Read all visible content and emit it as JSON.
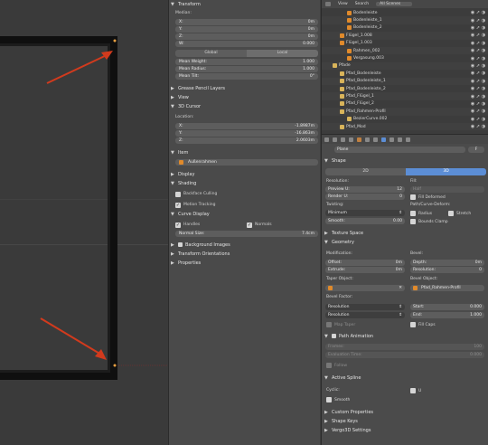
{
  "viewport": {},
  "npanel": {
    "transform": {
      "header": "Transform",
      "median_label": "Median:",
      "x": {
        "label": "X:",
        "value": "0m"
      },
      "y": {
        "label": "Y:",
        "value": "0m"
      },
      "z": {
        "label": "Z:",
        "value": "0m"
      },
      "w": {
        "label": "W:",
        "value": "0.000"
      },
      "global": "Global",
      "local": "Local",
      "mean_weight": {
        "label": "Mean Weight:",
        "value": "1.000"
      },
      "mean_radius": {
        "label": "Mean Radius:",
        "value": "1.000"
      },
      "mean_tilt": {
        "label": "Mean Tilt:",
        "value": "0°"
      }
    },
    "grease_pencil": "Grease Pencil Layers",
    "view": "View",
    "cursor": {
      "header": "3D Cursor",
      "location": "Location:",
      "x": {
        "label": "X:",
        "value": "-1.8987m"
      },
      "y": {
        "label": "Y:",
        "value": "-16.863m"
      },
      "z": {
        "label": "Z:",
        "value": "2.0603m"
      }
    },
    "item": {
      "header": "Item",
      "name": "Außenrahmen"
    },
    "display": "Display",
    "shading": {
      "header": "Shading",
      "backface": "Backface Culling",
      "matcap": "Motion Tracking"
    },
    "curve_display": {
      "header": "Curve Display",
      "handles": "Handles",
      "normals": "Normals",
      "normal_size_label": "Normal Size:",
      "normal_size": "7.4cm"
    },
    "background": "Background Images",
    "transform_orient": "Transform Orientations",
    "properties": "Properties"
  },
  "outliner": {
    "view": "View",
    "search": "Search",
    "scenes": "All Scenes",
    "rows": [
      {
        "label": "Bodenleiste",
        "color": "#e08a2b"
      },
      {
        "label": "Bodenleiste_1",
        "color": "#e08a2b"
      },
      {
        "label": "Bodenleiste_2",
        "color": "#e08a2b"
      },
      {
        "label": "Flügel_1.008",
        "color": "#e08a2b"
      },
      {
        "label": "Flügel_1.003",
        "color": "#e08a2b"
      },
      {
        "label": "Rahmen_002",
        "color": "#e08a2b"
      },
      {
        "label": "Vergasung.003",
        "color": "#e08a2b"
      },
      {
        "label": "Pfade",
        "color": "#d9b45a"
      },
      {
        "label": "Pfad_Bodenleiste",
        "color": "#d9b45a"
      },
      {
        "label": "Pfad_Bodenleiste_1",
        "color": "#d9b45a"
      },
      {
        "label": "Pfad_Bodenleiste_2",
        "color": "#d9b45a"
      },
      {
        "label": "Pfad_Flügel_1",
        "color": "#d9b45a"
      },
      {
        "label": "Pfad_Flügel_2",
        "color": "#d9b45a"
      },
      {
        "label": "Pfad_Rahmen-Profil",
        "color": "#d9b45a"
      },
      {
        "label": "BezierCurve.002",
        "color": "#d9b45a"
      },
      {
        "label": "Pfad_Mod",
        "color": "#d9b45a"
      }
    ]
  },
  "props": {
    "object_name": "Plane",
    "f_label": "F",
    "shape": {
      "header": "Shape",
      "two_d": "2D",
      "three_d": "3D",
      "resolution": "Resolution:",
      "preview_u": {
        "label": "Preview U:",
        "value": "12"
      },
      "render_u": {
        "label": "Render U:",
        "value": "0"
      },
      "fill": "Fill:",
      "fill_value": "Half",
      "fill_deformed": "Fill Deformed",
      "twisting": "Twisting:",
      "twist_value": "Minimum",
      "smooth": {
        "label": "Smooth:",
        "value": "0.00"
      },
      "path_deform": "Path/Curve-Deform:",
      "radius": "Radius",
      "stretch": "Stretch",
      "bounds": "Bounds Clamp"
    },
    "texture_space": "Texture Space",
    "geometry": {
      "header": "Geometry",
      "modification": "Modification:",
      "offset": {
        "label": "Offset:",
        "value": "0m"
      },
      "extrude": {
        "label": "Extrude:",
        "value": "0m"
      },
      "bevel": "Bevel:",
      "depth": {
        "label": "Depth:",
        "value": "0m"
      },
      "resolution": {
        "label": "Resolution:",
        "value": "0"
      },
      "taper": "Taper Object:",
      "bevel_obj": "Bevel Object:",
      "bevel_obj_value": "Pfad_Rahmen-Profil",
      "bevel_factor": "Bevel Factor:",
      "res1": "Resolution",
      "res2": "Resolution",
      "start": {
        "label": "Start:",
        "value": "0.000"
      },
      "end": {
        "label": "End:",
        "value": "1.000"
      },
      "map_taper": "Map Taper",
      "fill_caps": "Fill Caps"
    },
    "path_animation": {
      "header": "Path Animation",
      "frames": {
        "label": "Frames:",
        "value": "100"
      },
      "eval": {
        "label": "Evaluation Time:",
        "value": "0.000"
      },
      "follow": "Follow"
    },
    "active_spline": {
      "header": "Active Spline",
      "cyclic": "Cyclic:",
      "u": "U",
      "smooth": "Smooth"
    },
    "custom": "Custom Properties",
    "shape_keys": "Shape Keys",
    "vergo": "Vergo3D Settings"
  }
}
